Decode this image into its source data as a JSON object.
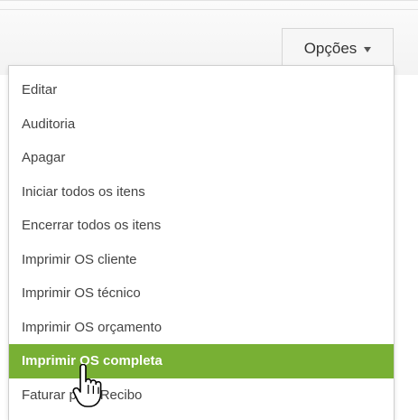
{
  "toolbar": {
    "options_label": "Opções",
    "options_icon": "caret-down-icon"
  },
  "menu": {
    "items": [
      {
        "label": "Editar",
        "active": false
      },
      {
        "label": "Auditoria",
        "active": false
      },
      {
        "label": "Apagar",
        "active": false
      },
      {
        "label": "Iniciar todos os itens",
        "active": false
      },
      {
        "label": "Encerrar todos os itens",
        "active": false
      },
      {
        "label": "Imprimir OS cliente",
        "active": false
      },
      {
        "label": "Imprimir OS técnico",
        "active": false
      },
      {
        "label": "Imprimir OS orçamento",
        "active": false
      },
      {
        "label": "Imprimir OS completa",
        "active": true
      },
      {
        "label": "Faturar para Recibo",
        "active": false
      }
    ]
  },
  "colors": {
    "highlight": "#78b034",
    "menu_text": "#444444",
    "border": "#cfcfcf"
  },
  "cursor": {
    "icon": "hand-pointer-icon"
  }
}
